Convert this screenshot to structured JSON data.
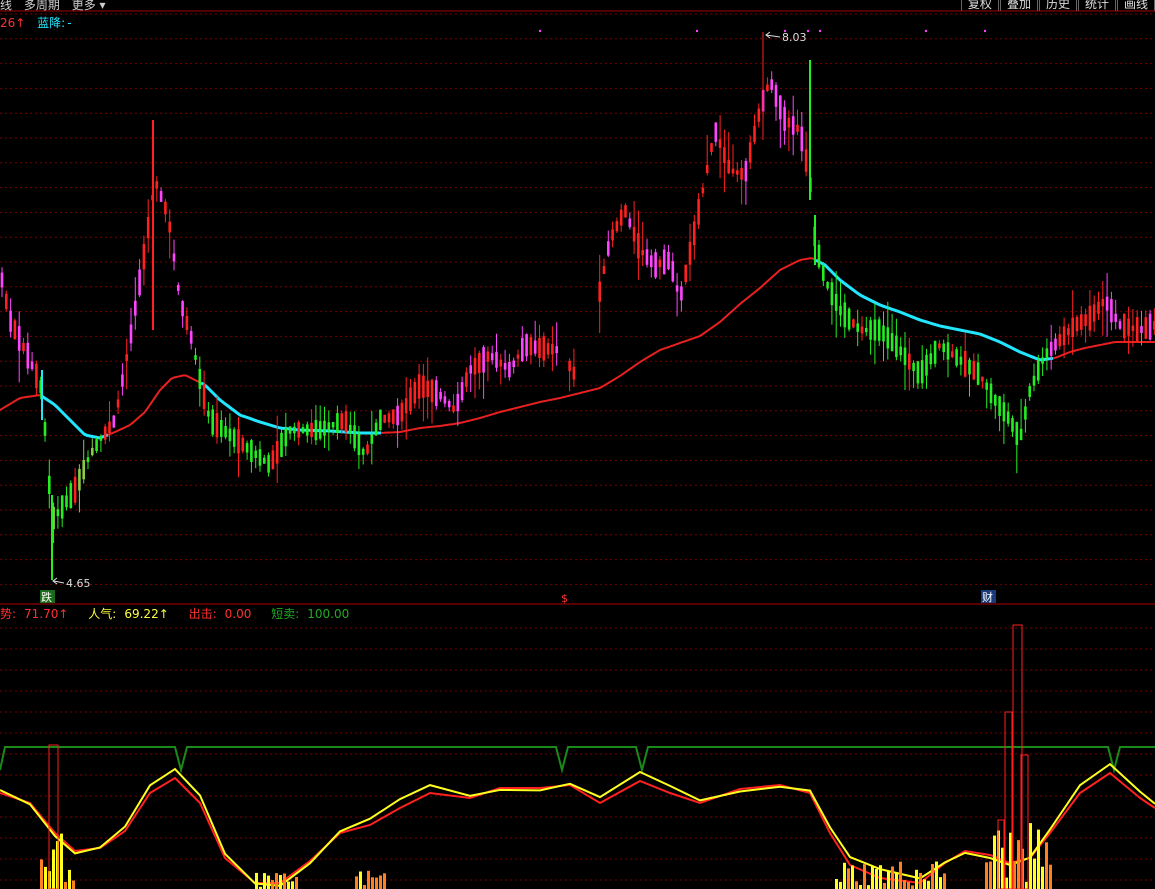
{
  "toolbar": {
    "menu": [
      "线",
      "多周期",
      "更多 ▾"
    ],
    "buttons": [
      "复权",
      "叠加",
      "历史",
      "统计",
      "画线"
    ]
  },
  "main_panel": {
    "readout": {
      "first": "26↑",
      "second_label": "蓝降:",
      "second_value": "-"
    },
    "high_label": "8.03",
    "low_label": "4.65",
    "markers": [
      "跌",
      "$",
      "财"
    ]
  },
  "indicator_panel": {
    "readout": [
      {
        "label": "势:",
        "value": "71.70↑",
        "color": "#ff3030"
      },
      {
        "label": "人气:",
        "value": "69.22↑",
        "color": "#ffff40"
      },
      {
        "label": "出击:",
        "value": "0.00",
        "color": "#ff3030"
      },
      {
        "label": "短卖:",
        "value": "100.00",
        "color": "#22aa22"
      }
    ]
  },
  "colors": {
    "up": "#ff2020",
    "down": "#22ee22",
    "magenta": "#ff44ff",
    "cyan": "#22e6ff",
    "ma_red": "#e82020",
    "grid": "#7a0000",
    "yellow": "#ffff20",
    "green_line": "#1a8a1a"
  }
}
